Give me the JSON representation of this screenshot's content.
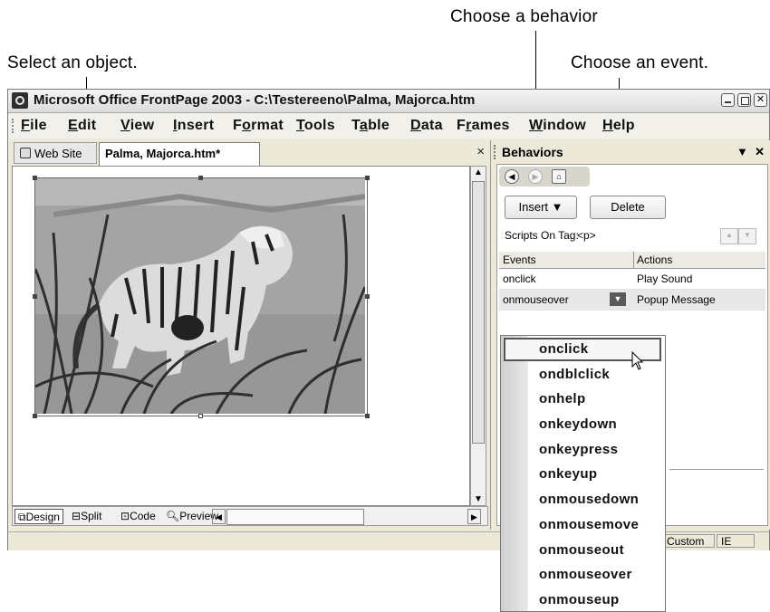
{
  "callouts": {
    "behavior": "Choose a behavior",
    "object": "Select an object.",
    "event": "Choose an event."
  },
  "window": {
    "title": "Microsoft Office FrontPage 2003 - C:\\Testereeno\\Palma, Majorca.htm"
  },
  "menu": [
    {
      "u": "F",
      "rest": "ile"
    },
    {
      "u": "E",
      "rest": "dit"
    },
    {
      "u": "V",
      "rest": "iew"
    },
    {
      "u": "I",
      "rest": "nsert"
    },
    {
      "pre": "F",
      "u": "o",
      "rest": "rmat"
    },
    {
      "u": "T",
      "rest": "ools"
    },
    {
      "pre": "T",
      "u": "a",
      "rest": "ble"
    },
    {
      "u": "D",
      "rest": "ata"
    },
    {
      "pre": "F",
      "u": "r",
      "rest": "ames"
    },
    {
      "u": "W",
      "rest": "indow"
    },
    {
      "u": "H",
      "rest": "elp"
    }
  ],
  "tabs": {
    "website": "Web Site",
    "document": "Palma, Majorca.htm*",
    "close": "×"
  },
  "view_tabs": {
    "design": "Design",
    "split": "Split",
    "code": "Code",
    "preview": "Preview"
  },
  "status": {
    "custom": "Custom",
    "ie": "IE"
  },
  "pane": {
    "title": "Behaviors",
    "insert_label": "Insert",
    "delete_label": "Delete",
    "scripts_on_tag_label": "Scripts On Tag:",
    "tag_value": "<p>",
    "columns": [
      "Events",
      "Actions"
    ],
    "rows": [
      {
        "event": "onclick",
        "action": "Play Sound"
      },
      {
        "event": "onmouseover",
        "action": "Popup Message"
      }
    ]
  },
  "event_dropdown": {
    "items": [
      "onclick",
      "ondblclick",
      "onhelp",
      "onkeydown",
      "onkeypress",
      "onkeyup",
      "onmousedown",
      "onmousemove",
      "onmouseout",
      "onmouseover",
      "onmouseup"
    ]
  },
  "colors": {
    "chrome": "#ece9d8",
    "image_gray": "#9e9e9e"
  }
}
